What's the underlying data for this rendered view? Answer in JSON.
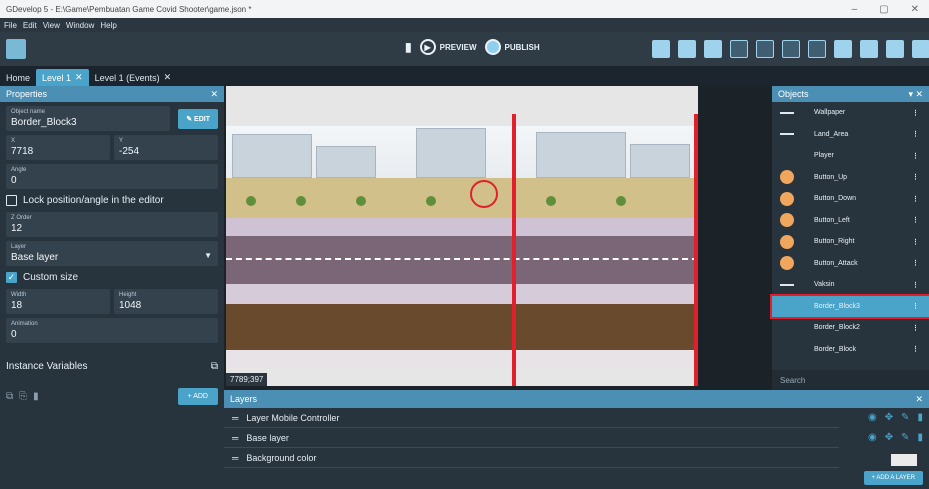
{
  "window": {
    "title": "GDevelop 5 - E:\\Game\\Pembuatan Game Covid Shooter\\game.json *",
    "controls": [
      "–",
      "▢",
      "✕"
    ]
  },
  "menu": [
    "File",
    "Edit",
    "View",
    "Window",
    "Help"
  ],
  "toolbar": {
    "preview_label": "PREVIEW",
    "publish_label": "PUBLISH"
  },
  "tabs": [
    {
      "label": "Home"
    },
    {
      "label": "Level 1",
      "close": "✕"
    },
    {
      "label": "Level 1 (Events)",
      "close": "✕"
    }
  ],
  "properties": {
    "title": "Properties",
    "object_name_label": "Object name",
    "object_name": "Border_Block3",
    "edit_label": "EDIT",
    "x_label": "X",
    "x": "7718",
    "y_label": "Y",
    "y": "-254",
    "angle_label": "Angle",
    "angle": "0",
    "lock_label": "Lock position/angle in the editor",
    "zorder_label": "Z Order",
    "zorder": "12",
    "layer_label": "Layer",
    "layer": "Base layer",
    "custom_size_label": "Custom size",
    "width_label": "Width",
    "width": "18",
    "height_label": "Height",
    "height": "1048",
    "animation_label": "Animation",
    "animation": "0",
    "instance_vars_label": "Instance Variables",
    "add_label": "+ ADD"
  },
  "canvas": {
    "coords": "7789;397"
  },
  "objects": {
    "title": "Objects",
    "items": [
      {
        "label": "Wallpaper",
        "icon": "line"
      },
      {
        "label": "Land_Area",
        "icon": "line"
      },
      {
        "label": "Player",
        "icon": "none"
      },
      {
        "label": "Button_Up",
        "icon": "circle"
      },
      {
        "label": "Button_Down",
        "icon": "circle"
      },
      {
        "label": "Button_Left",
        "icon": "circle"
      },
      {
        "label": "Button_Right",
        "icon": "circle"
      },
      {
        "label": "Button_Attack",
        "icon": "circle"
      },
      {
        "label": "Vaksin",
        "icon": "line"
      },
      {
        "label": "Border_Block3",
        "icon": "none",
        "selected": true
      },
      {
        "label": "Border_Block2",
        "icon": "none"
      },
      {
        "label": "Border_Block",
        "icon": "none"
      }
    ],
    "search_placeholder": "Search"
  },
  "layers": {
    "title": "Layers",
    "items": [
      "Layer Mobile Controller",
      "Base layer",
      "Background color"
    ],
    "add_layer_label": "+ ADD A LAYER"
  },
  "colors": {
    "accent": "#4aa3c8",
    "highlight": "#e0212b",
    "panel": "#27333d"
  }
}
